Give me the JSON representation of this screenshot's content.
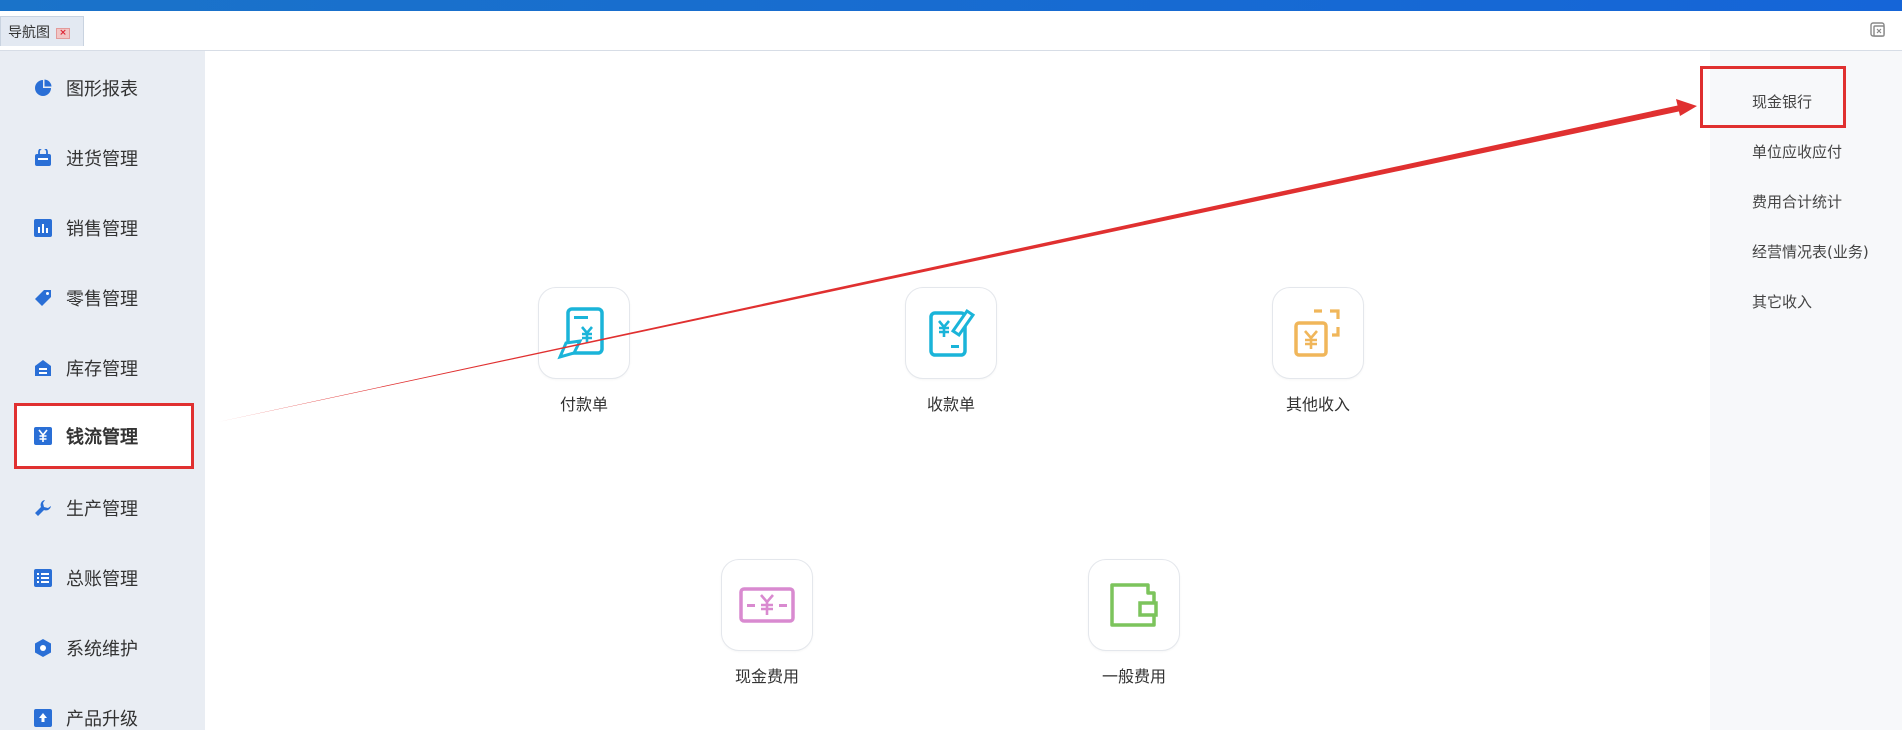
{
  "tab": {
    "label": "导航图"
  },
  "sidebar": {
    "items": [
      {
        "label": "图形报表",
        "icon": "pie-chart-icon"
      },
      {
        "label": "进货管理",
        "icon": "basket-icon"
      },
      {
        "label": "销售管理",
        "icon": "bar-chart-icon"
      },
      {
        "label": "零售管理",
        "icon": "tag-icon"
      },
      {
        "label": "库存管理",
        "icon": "warehouse-icon"
      },
      {
        "label": "钱流管理",
        "icon": "yen-icon",
        "active": true
      },
      {
        "label": "生产管理",
        "icon": "wrench-icon"
      },
      {
        "label": "总账管理",
        "icon": "list-icon"
      },
      {
        "label": "系统维护",
        "icon": "hexagon-icon"
      },
      {
        "label": "产品升级",
        "icon": "upload-icon"
      }
    ]
  },
  "main": {
    "tiles": [
      {
        "label": "付款单",
        "icon": "payment-voucher-icon",
        "color": "#1ab4d9"
      },
      {
        "label": "收款单",
        "icon": "receipt-voucher-icon",
        "color": "#1ab4d9"
      },
      {
        "label": "其他收入",
        "icon": "other-income-icon",
        "color": "#f0b65a"
      },
      {
        "label": "现金费用",
        "icon": "cash-expense-icon",
        "color": "#d98ad0"
      },
      {
        "label": "一般费用",
        "icon": "wallet-icon",
        "color": "#7cc45c"
      }
    ]
  },
  "rightpanel": {
    "items": [
      {
        "label": "现金银行"
      },
      {
        "label": "单位应收应付"
      },
      {
        "label": "费用合计统计"
      },
      {
        "label": "经营情况表(业务)"
      },
      {
        "label": "其它收入"
      }
    ]
  },
  "colors": {
    "accent": "#2a6fd6",
    "highlight": "#e03030",
    "topbar": "#1565d8"
  }
}
